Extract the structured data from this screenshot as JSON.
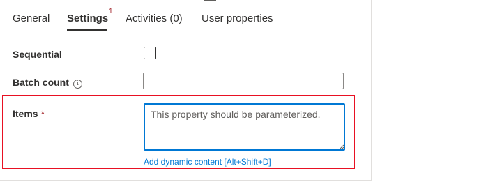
{
  "tabs": [
    {
      "label": "General"
    },
    {
      "label": "Settings",
      "badge": "1"
    },
    {
      "label": "Activities (0)"
    },
    {
      "label": "User properties"
    }
  ],
  "fields": {
    "sequential": {
      "label": "Sequential",
      "checked": false
    },
    "batch_count": {
      "label": "Batch count",
      "info_glyph": "i",
      "value": ""
    },
    "items": {
      "label": "Items",
      "required_mark": "*",
      "placeholder": "This property should be parameterized.",
      "value": ""
    }
  },
  "dynamic_content_link": "Add dynamic content [Alt+Shift+D]",
  "colors": {
    "accent": "#0078d4",
    "required": "#a4262c",
    "highlight": "#e81123"
  },
  "icons": {
    "info": "info-circle-icon",
    "resize": "resize-grip-icon"
  }
}
